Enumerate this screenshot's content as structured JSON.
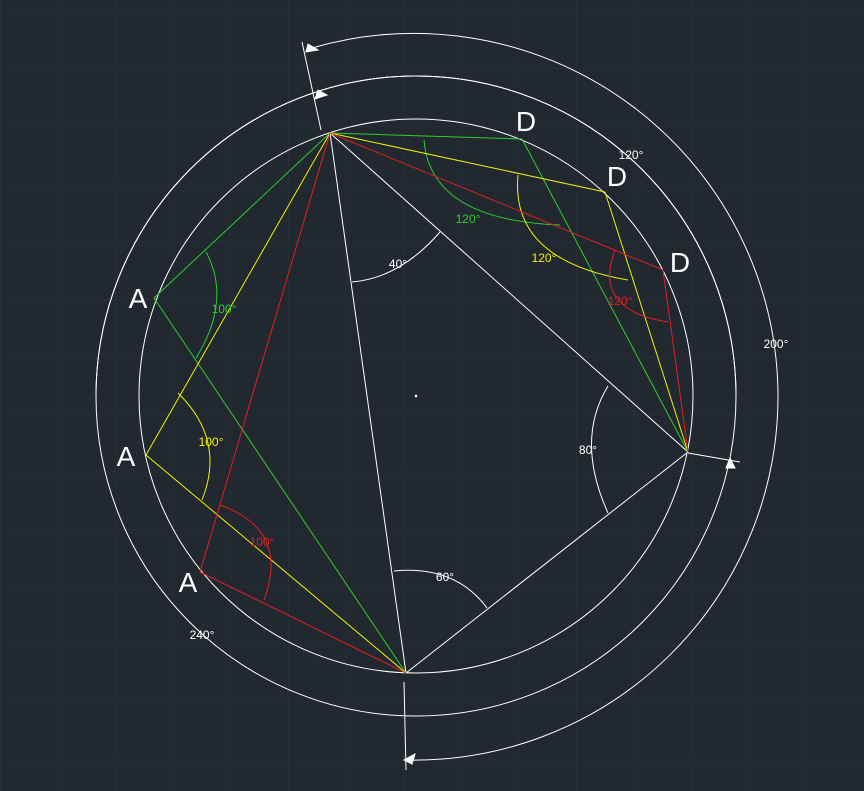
{
  "colors": {
    "background": "#212830",
    "grid": "#2c343e",
    "white": "#ffffff",
    "green": "#2ecc2e",
    "yellow": "#f2f200",
    "red": "#e41e1e"
  },
  "points": {
    "A1": "A",
    "A2": "A",
    "A3": "A",
    "D1": "D",
    "D2": "D",
    "D3": "D"
  },
  "angles": {
    "top_center": "40°",
    "right_center": "80°",
    "bottom_center": "60°",
    "outer_120": "120°",
    "outer_200": "200°",
    "outer_240": "240°",
    "green_D": "120°",
    "yellow_D": "120°",
    "red_D": "120°",
    "green_A": "100°",
    "yellow_A": "100°",
    "red_A": "100°"
  }
}
